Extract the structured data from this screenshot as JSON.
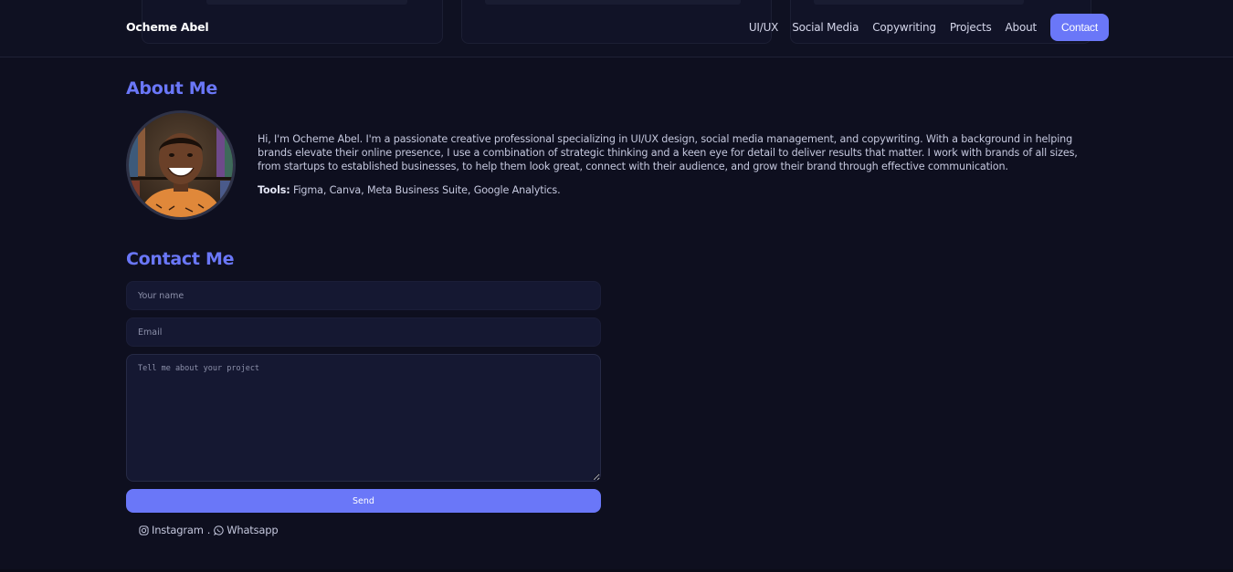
{
  "header": {
    "brand": "Ocheme Abel",
    "nav": [
      "UI/UX",
      "Social Media",
      "Copywriting",
      "Projects",
      "About"
    ],
    "contact_label": "Contact"
  },
  "about": {
    "title": "About Me",
    "bio": "Hi, I'm Ocheme Abel. I'm a passionate creative professional specializing in UI/UX design, social media management, and copywriting. With a background in helping brands elevate their online presence, I use a combination of strategic thinking and a keen eye for detail to deliver results that matter. I work with brands of all sizes, from startups to established businesses, to help them look great, connect with their audience, and grow their brand through effective communication.",
    "tools_label": "Tools:",
    "tools_value": "Figma, Canva, Meta Business Suite, Google Analytics."
  },
  "contact": {
    "title": "Contact Me",
    "name_placeholder": "Your name",
    "email_placeholder": "Email",
    "message_placeholder": "Tell me about your project",
    "send_label": "Send",
    "instagram_label": "Instagram",
    "separator": ".",
    "whatsapp_label": "Whatsapp"
  },
  "colors": {
    "accent": "#6a77f8",
    "background": "#0e0f1f",
    "input_background": "#151832"
  }
}
